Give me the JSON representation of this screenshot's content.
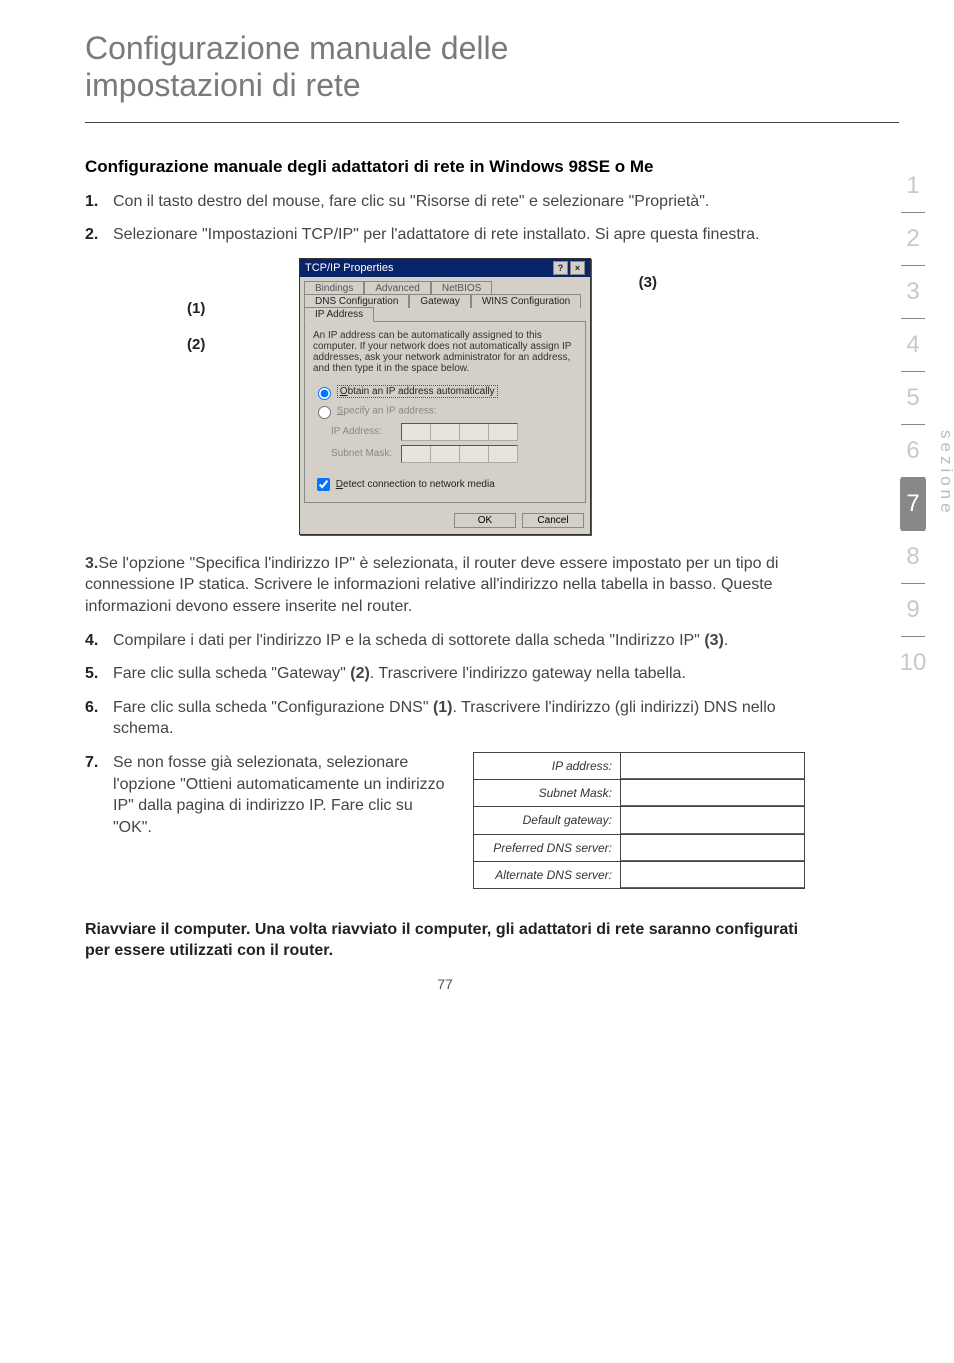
{
  "title_line1": "Configurazione manuale delle",
  "title_line2": "impostazioni di rete",
  "subhead": "Configurazione manuale degli adattatori di rete in Windows 98SE o Me",
  "items": {
    "n1": "1.",
    "t1": "Con il tasto destro del mouse, fare clic su \"Risorse di rete\" e selezionare \"Proprietà\".",
    "n2": "2.",
    "t2": "Selezionare \"Impostazioni TCP/IP\" per l'adattatore di rete installato. Si apre questa finestra.",
    "n3": "3.",
    "t3": "Se l'opzione \"Specifica l'indirizzo IP\" è selezionata, il router deve essere impostato per un tipo di connessione IP statica. Scrivere le informazioni relative all'indirizzo nella tabella in basso. Queste informazioni devono essere inserite nel router.",
    "n4": "4.",
    "t4a": "Compilare i dati per l'indirizzo IP e la scheda di sottorete dalla scheda \"Indirizzo IP\" ",
    "t4b": "(3)",
    "t4c": ".",
    "n5": "5.",
    "t5a": "Fare clic sulla scheda \"Gateway\" ",
    "t5b": "(2)",
    "t5c": ". Trascrivere l'indirizzo gateway nella tabella.",
    "n6": "6.",
    "t6a": "Fare clic sulla scheda \"Configurazione DNS\" ",
    "t6b": "(1)",
    "t6c": ". Trascrivere l'indirizzo (gli indirizzi) DNS nello schema.",
    "n7": "7.",
    "t7": "Se non fosse già selezionata, selezionare l'opzione \"Ottieni automaticamente un indirizzo IP\" dalla pagina di indirizzo IP. Fare clic su \"OK\"."
  },
  "callouts": {
    "c1": "(1)",
    "c2": "(2)",
    "c3": "(3)"
  },
  "dialog": {
    "title": "TCP/IP Properties",
    "help": "?",
    "close": "×",
    "tabs_back": {
      "bindings": "Bindings",
      "advanced": "Advanced",
      "netbios": "NetBIOS"
    },
    "tabs_front": {
      "dns": "DNS Configuration",
      "gateway": "Gateway",
      "wins": "WINS Configuration",
      "ip": "IP Address"
    },
    "para": "An IP address can be automatically assigned to this computer. If your network does not automatically assign IP addresses, ask your network administrator for an address, and then type it in the space below.",
    "opt_obtain_pre": "O",
    "opt_obtain": "btain an IP address automatically",
    "opt_specify_pre": "S",
    "opt_specify": "pecify an IP address:",
    "ip_label": "IP Address:",
    "mask_label": "Subnet Mask:",
    "detect_pre": "D",
    "detect": "etect connection to network media",
    "ok": "OK",
    "cancel": "Cancel"
  },
  "note_table": {
    "r1": "IP address:",
    "r2": "Subnet Mask:",
    "r3": "Default gateway:",
    "r4": "Preferred DNS server:",
    "r5": "Alternate DNS server:"
  },
  "footer": "Riavviare il computer. Una volta riavviato il computer, gli adattatori di rete saranno configurati per essere utilizzati con il router.",
  "page_num": "77",
  "sidenav": {
    "s1": "1",
    "s2": "2",
    "s3": "3",
    "s4": "4",
    "s5": "5",
    "s6": "6",
    "s7": "7",
    "s8": "8",
    "s9": "9",
    "s10": "10",
    "sez": "sezione"
  }
}
